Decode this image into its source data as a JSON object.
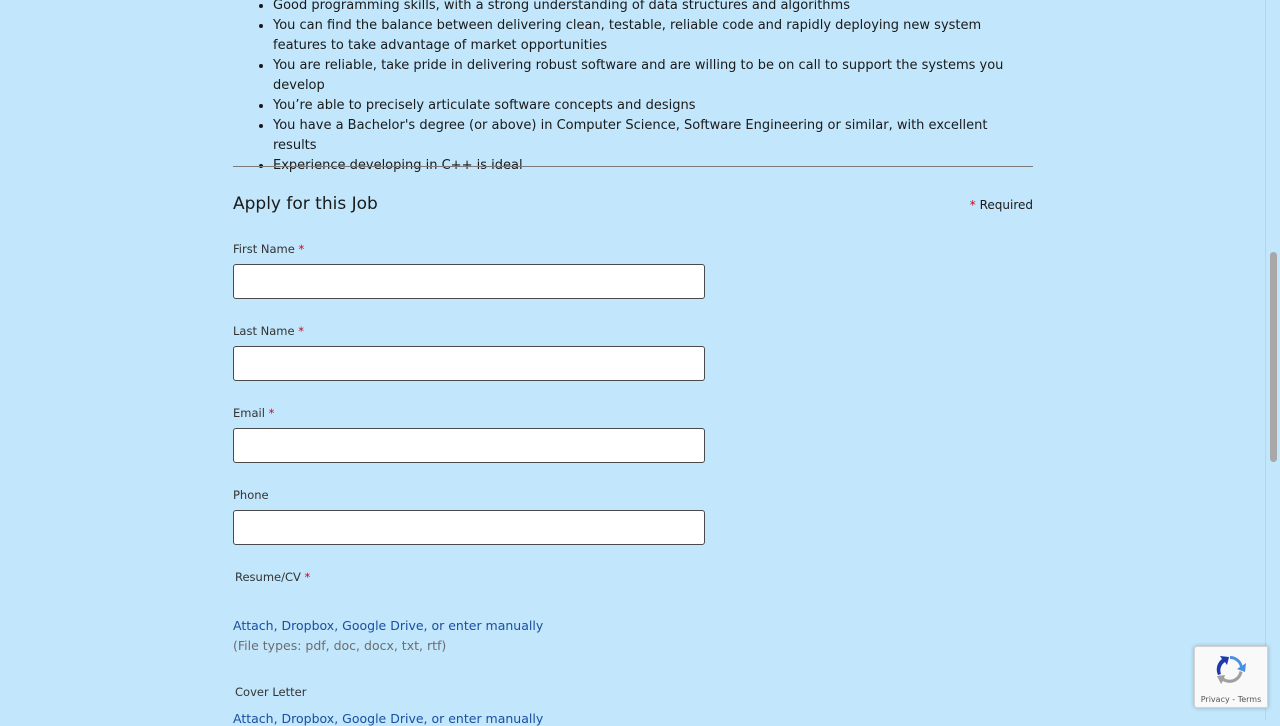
{
  "requirements": [
    "Good programming skills, with a strong understanding of data structures and algorithms",
    "You can find the balance between delivering clean, testable, reliable code and rapidly deploying new system features to take advantage of market opportunities",
    "You are reliable, take pride in delivering robust software and are willing to be on call to support the systems you develop",
    "You’re able to precisely articulate software concepts and designs",
    "You have a Bachelor's degree (or above) in Computer Science, Software Engineering or similar, with excellent results",
    "Experience developing in C++ is ideal"
  ],
  "apply": {
    "title": "Apply for this Job",
    "required_asterisk": "*",
    "required_label": "Required"
  },
  "fields": {
    "first_name": {
      "label": "First Name",
      "asterisk": "*"
    },
    "last_name": {
      "label": "Last Name",
      "asterisk": "*"
    },
    "email": {
      "label": "Email",
      "asterisk": "*"
    },
    "phone": {
      "label": "Phone"
    },
    "resume": {
      "label": "Resume/CV",
      "asterisk": "*",
      "link": "Attach, Dropbox, Google Drive, or enter manually",
      "filetypes": "(File types: pdf, doc, docx, txt, rtf)"
    },
    "cover_letter": {
      "label": "Cover Letter",
      "link": "Attach, Dropbox, Google Drive, or enter manually"
    }
  },
  "recaptcha": {
    "privacy": "Privacy",
    "separator": " - ",
    "terms": "Terms"
  },
  "colors": {
    "background": "#c2e6fb",
    "required_asterisk": "#d0021b",
    "link": "#1a4fa0"
  }
}
